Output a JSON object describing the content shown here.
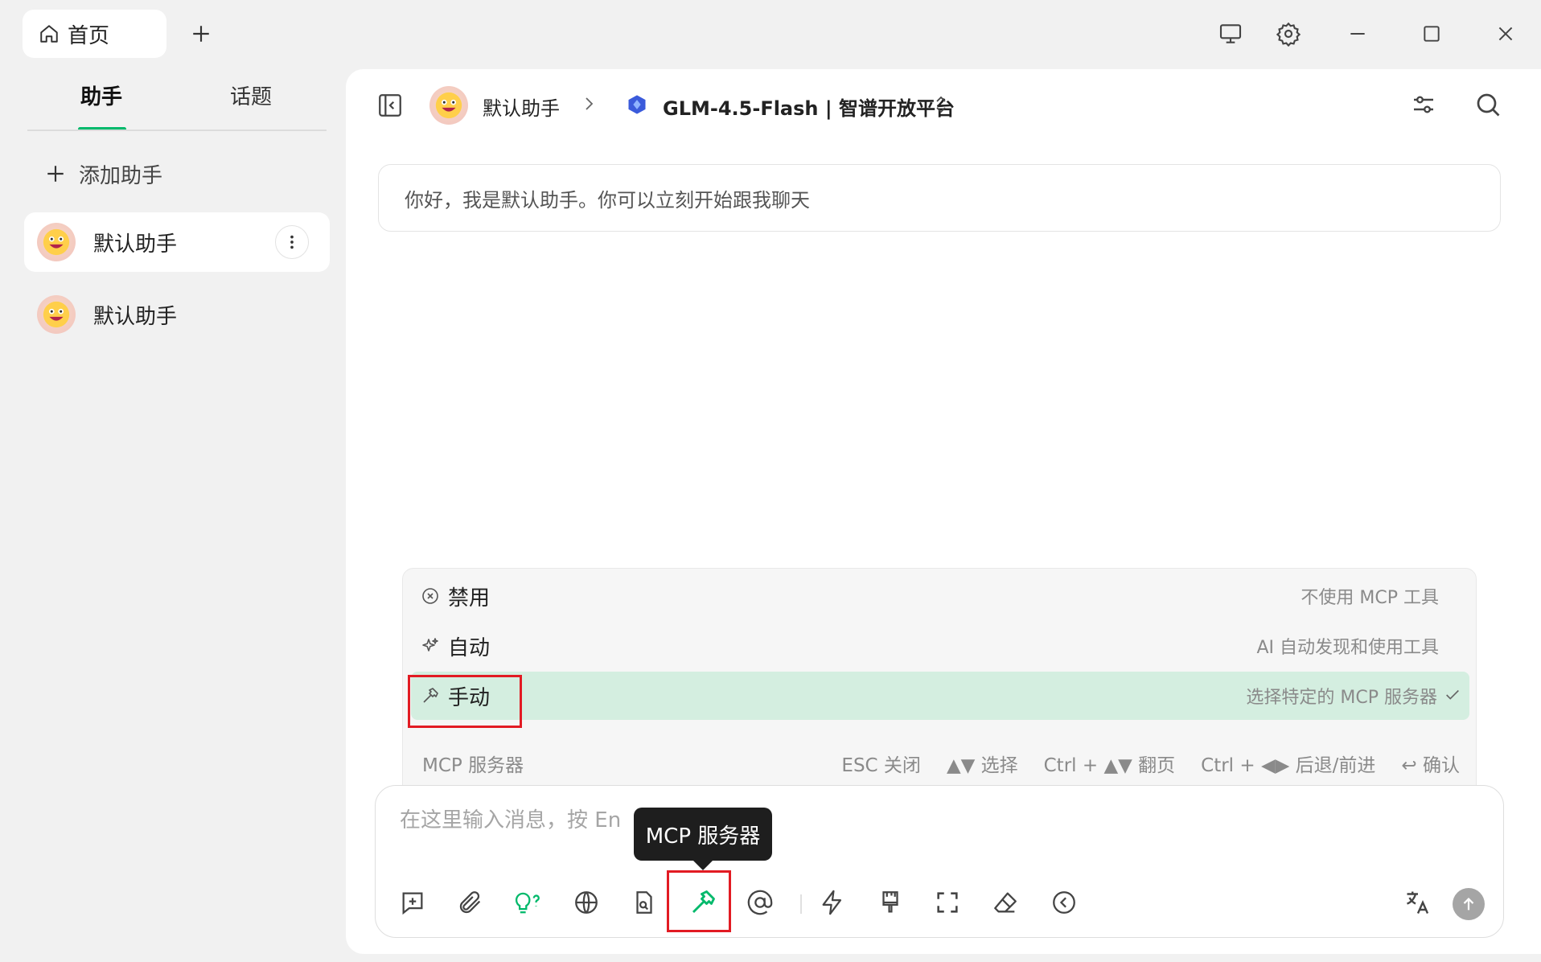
{
  "titlebar": {
    "home_tab_label": "首页",
    "window_controls": [
      "monitor-icon",
      "gear-icon",
      "minimize-icon",
      "maximize-icon",
      "close-icon"
    ]
  },
  "sidebar": {
    "tabs": [
      {
        "label": "助手",
        "active": true
      },
      {
        "label": "话题",
        "active": false
      }
    ],
    "add_label": "添加助手",
    "assistants": [
      {
        "name": "默认助手",
        "selected": true
      },
      {
        "name": "默认助手",
        "selected": false
      }
    ]
  },
  "header": {
    "assistant_name": "默认助手",
    "model_name": "GLM-4.5-Flash | 智谱开放平台"
  },
  "chat": {
    "welcome": "你好，我是默认助手。你可以立刻开始跟我聊天"
  },
  "mcp_menu": {
    "options": [
      {
        "label": "禁用",
        "desc": "不使用 MCP 工具",
        "icon": "circle-x-icon",
        "selected": false
      },
      {
        "label": "自动",
        "desc": "AI 自动发现和使用工具",
        "icon": "sparkle-icon",
        "selected": false
      },
      {
        "label": "手动",
        "desc": "选择特定的 MCP 服务器",
        "icon": "hammer-icon",
        "selected": true
      }
    ],
    "footer_title": "MCP 服务器",
    "hints": {
      "esc": "ESC 关闭",
      "select": "▲▼ 选择",
      "page": "Ctrl + ▲▼ 翻页",
      "nav": "Ctrl + ◀▶ 后退/前进",
      "confirm": "↩ 确认"
    }
  },
  "input": {
    "placeholder_visible": "在这里输入消息，按 En",
    "tooltip": "MCP 服务器"
  },
  "colors": {
    "accent": "#00b96b",
    "selected_row": "#d4eee0",
    "highlight_box": "#e21b23"
  }
}
